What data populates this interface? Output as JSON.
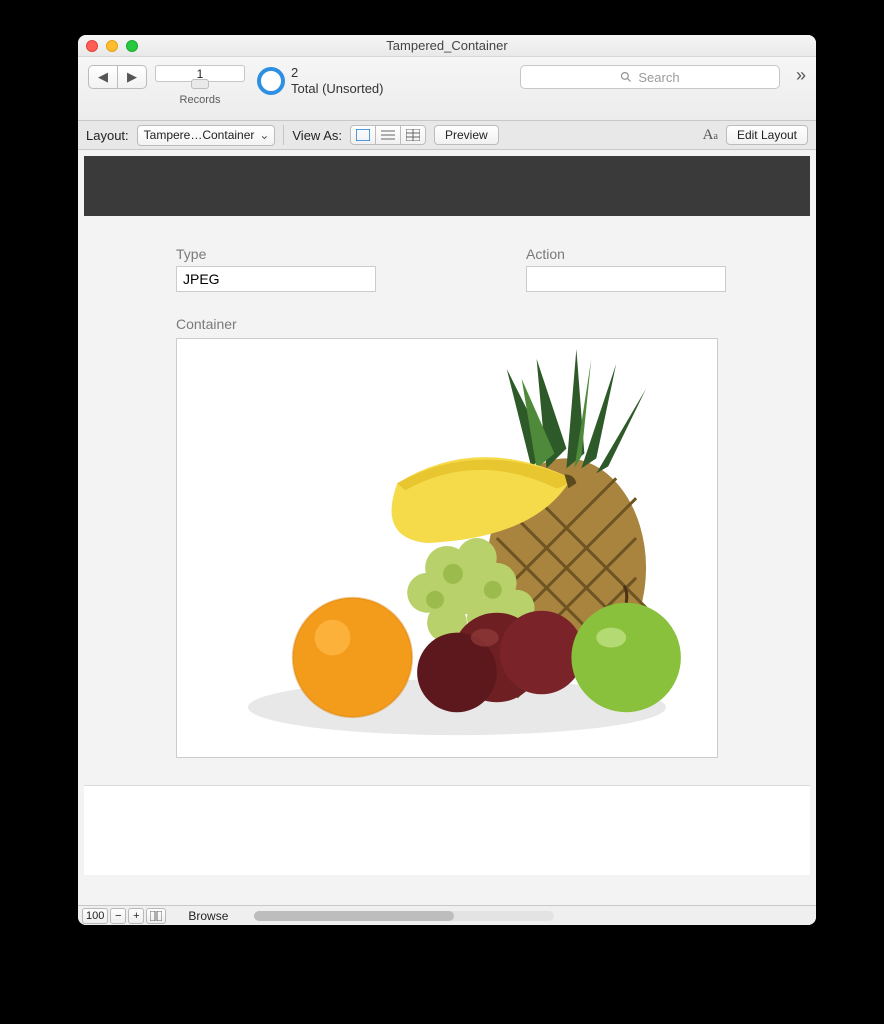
{
  "title": "Tampered_Container",
  "nav": {
    "record_current": "1",
    "record_total": "2",
    "sort_state": "Total (Unsorted)",
    "records_label": "Records"
  },
  "search": {
    "placeholder": "Search"
  },
  "layoutbar": {
    "layout_label": "Layout:",
    "layout_value": "Tampere…Container",
    "viewas_label": "View As:",
    "preview": "Preview",
    "editlayout": "Edit Layout"
  },
  "fields": {
    "type_label": "Type",
    "type_value": "JPEG",
    "action_label": "Action",
    "action_value": "",
    "container_label": "Container"
  },
  "status": {
    "zoom": "100",
    "mode": "Browse"
  }
}
